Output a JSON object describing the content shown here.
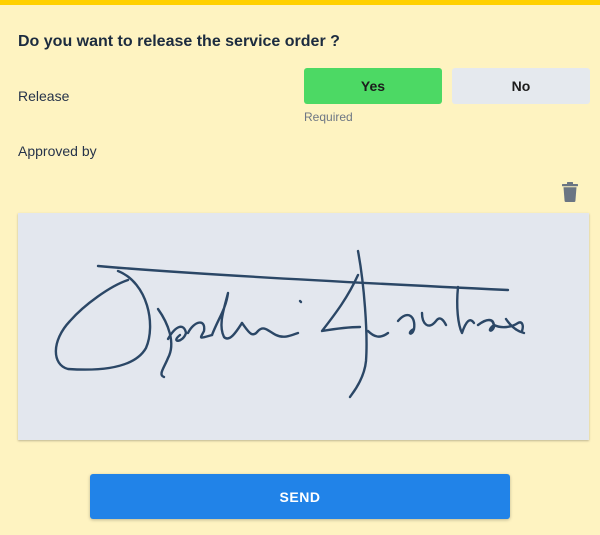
{
  "form": {
    "question": "Do you want to release the service order ?",
    "release_label": "Release",
    "yes_label": "Yes",
    "no_label": "No",
    "required_text": "Required",
    "approved_by_label": "Approved by",
    "delete_icon": "trash-icon",
    "send_label": "SEND"
  },
  "colors": {
    "top_bar": "#ffd000",
    "background": "#fef3c1",
    "yes_selected": "#4cd964",
    "no_unselected": "#e5e9ee",
    "signature_pad": "#e3e7ee",
    "signature_ink": "#2b4766",
    "send_button": "#2183e8"
  },
  "release": {
    "selected": "Yes"
  }
}
